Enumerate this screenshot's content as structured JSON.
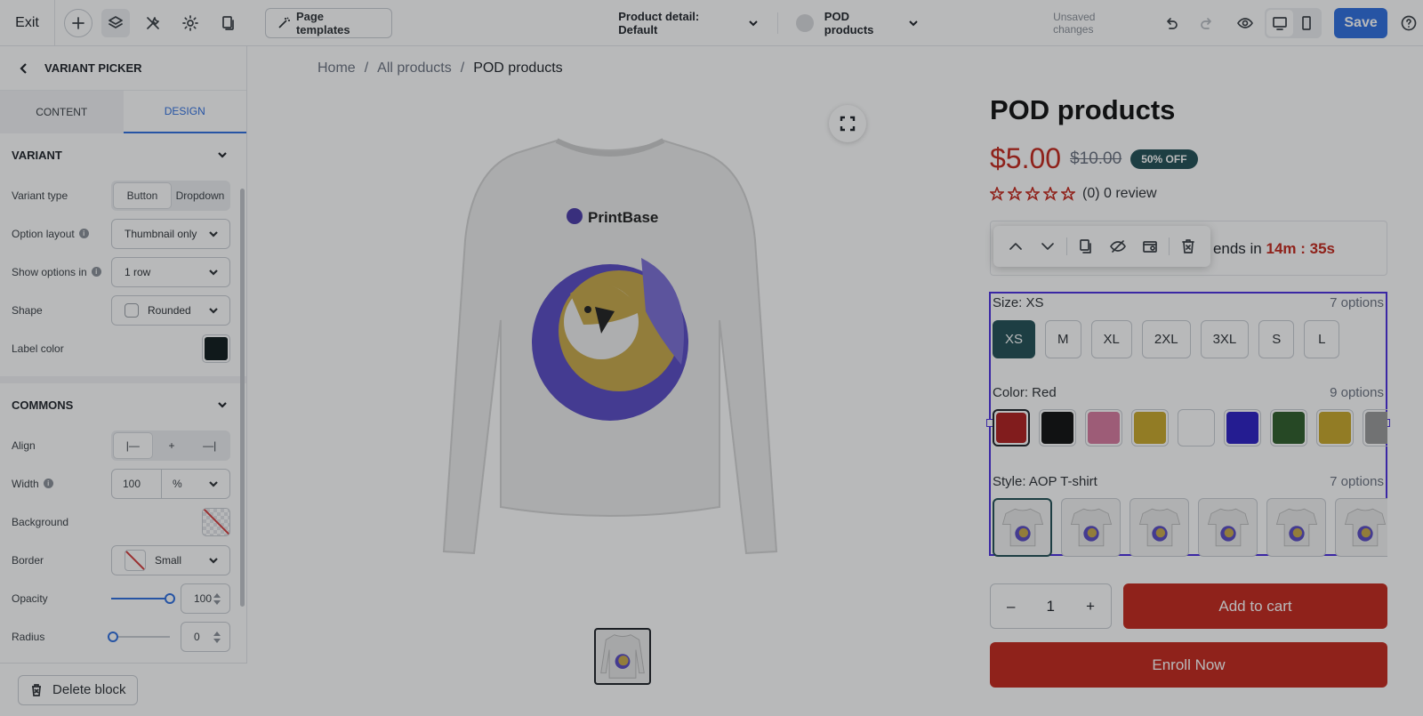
{
  "topbar": {
    "exit_label": "Exit",
    "page_templates_label": "Page templates",
    "page_selector_label": "Product detail: Default",
    "product_selector_label": "POD products",
    "unsaved_label": "Unsaved changes",
    "save_label": "Save",
    "icons": [
      "plus-icon",
      "layers-icon",
      "wrench-icon",
      "gear-icon",
      "pages-icon",
      "undo-icon",
      "redo-icon",
      "eye-icon",
      "desktop-icon",
      "mobile-icon",
      "help-icon"
    ]
  },
  "sidebar": {
    "title": "VARIANT PICKER",
    "tabs": [
      "CONTENT",
      "DESIGN"
    ],
    "active_tab": "DESIGN",
    "variant_section": {
      "title": "VARIANT",
      "variant_type_label": "Variant type",
      "variant_type_options": [
        "Button",
        "Dropdown"
      ],
      "variant_type_selected": "Button",
      "option_layout_label": "Option layout",
      "option_layout_value": "Thumbnail only",
      "show_options_label": "Show options in",
      "show_options_value": "1 row",
      "shape_label": "Shape",
      "shape_value": "Rounded",
      "label_color_label": "Label color",
      "label_color": "#0f1a1c"
    },
    "commons_section": {
      "title": "COMMONS",
      "align_label": "Align",
      "width_label": "Width",
      "width_value": "100",
      "width_unit": "%",
      "background_label": "Background",
      "border_label": "Border",
      "border_value": "Small",
      "opacity_label": "Opacity",
      "opacity_value": "100",
      "radius_label": "Radius",
      "radius_value": "0"
    },
    "delete_label": "Delete block"
  },
  "canvas": {
    "breadcrumb": [
      "Home",
      "All products",
      "POD products"
    ],
    "product_title": "POD products",
    "price": "$5.00",
    "old_price": "$10.00",
    "discount_badge": "50% OFF",
    "review_text": "(0) 0 review",
    "timer_label": "e ends in",
    "timer_value": "14m : 35s",
    "shirt_brand": "PrintBase",
    "size": {
      "label": "Size: XS",
      "count": "7 options",
      "options": [
        "XS",
        "M",
        "XL",
        "2XL",
        "3XL",
        "S",
        "L"
      ],
      "selected": "XS"
    },
    "color": {
      "label": "Color: Red",
      "count": "9 options",
      "swatches": [
        "#b01f1f",
        "#111111",
        "#d97a9f",
        "#c9a82a",
        "#ffffff",
        "#2b1fc4",
        "#2f5e2a",
        "#c9a82a",
        "#9a9a9a"
      ],
      "selected_index": 0
    },
    "style": {
      "label": "Style: AOP T-shirt",
      "count": "7 options",
      "thumbnails": 6,
      "selected_index": 0
    },
    "quantity": "1",
    "qty_minus": "–",
    "qty_plus": "+",
    "add_to_cart_label": "Add to cart",
    "enroll_label": "Enroll Now"
  }
}
